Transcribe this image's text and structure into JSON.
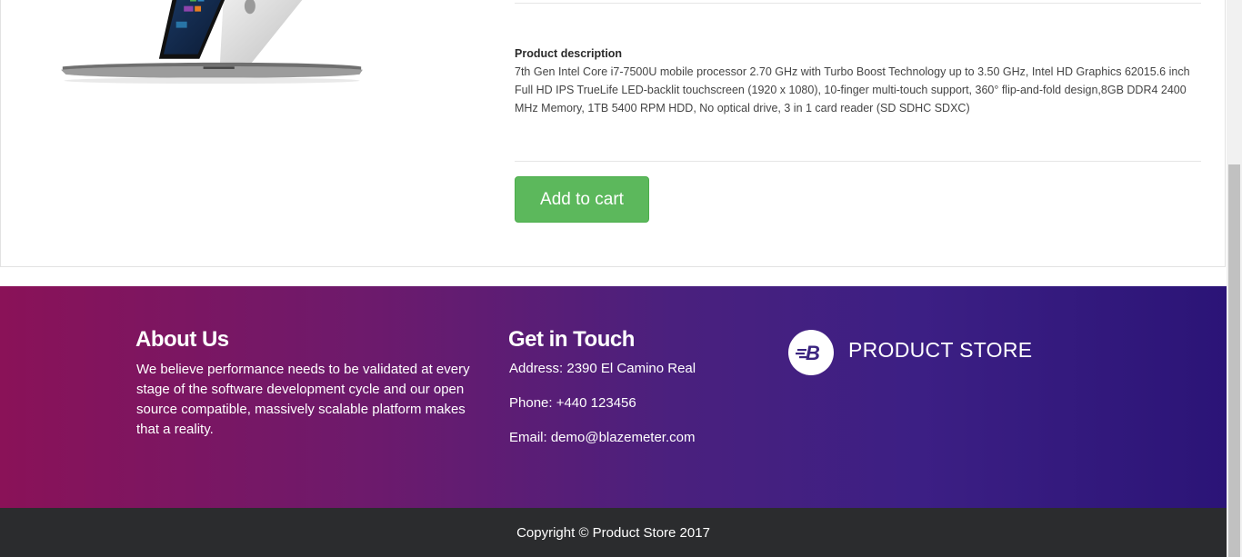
{
  "product": {
    "image_alt": "laptop-image",
    "description_title": "Product description",
    "description_text": "7th Gen Intel Core i7-7500U mobile processor 2.70 GHz with Turbo Boost Technology up to 3.50 GHz, Intel HD Graphics 62015.6 inch Full HD IPS TrueLife LED-backlit touchscreen (1920 x 1080), 10-finger multi-touch support, 360° flip-and-fold design,8GB DDR4 2400 MHz Memory, 1TB 5400 RPM HDD, No optical drive, 3 in 1 card reader (SD SDHC SDXC)",
    "add_to_cart_label": "Add to cart",
    "button_color": "#5cb85c"
  },
  "footer": {
    "about": {
      "title": "About Us",
      "text": "We believe performance needs to be validated at every stage of the software development cycle and our open source compatible, massively scalable platform makes that a reality."
    },
    "contact": {
      "title": "Get in Touch",
      "address": "Address: 2390 El Camino Real",
      "phone": "Phone: +440 123456",
      "email": "Email: demo@blazemeter.com"
    },
    "brand": {
      "logo_icon": "blazemeter-b-icon",
      "name": "PRODUCT STORE"
    },
    "gradient_colors": [
      "#8a1258",
      "#4a207e",
      "#2b1477"
    ]
  },
  "copyright": "Copyright © Product Store 2017"
}
